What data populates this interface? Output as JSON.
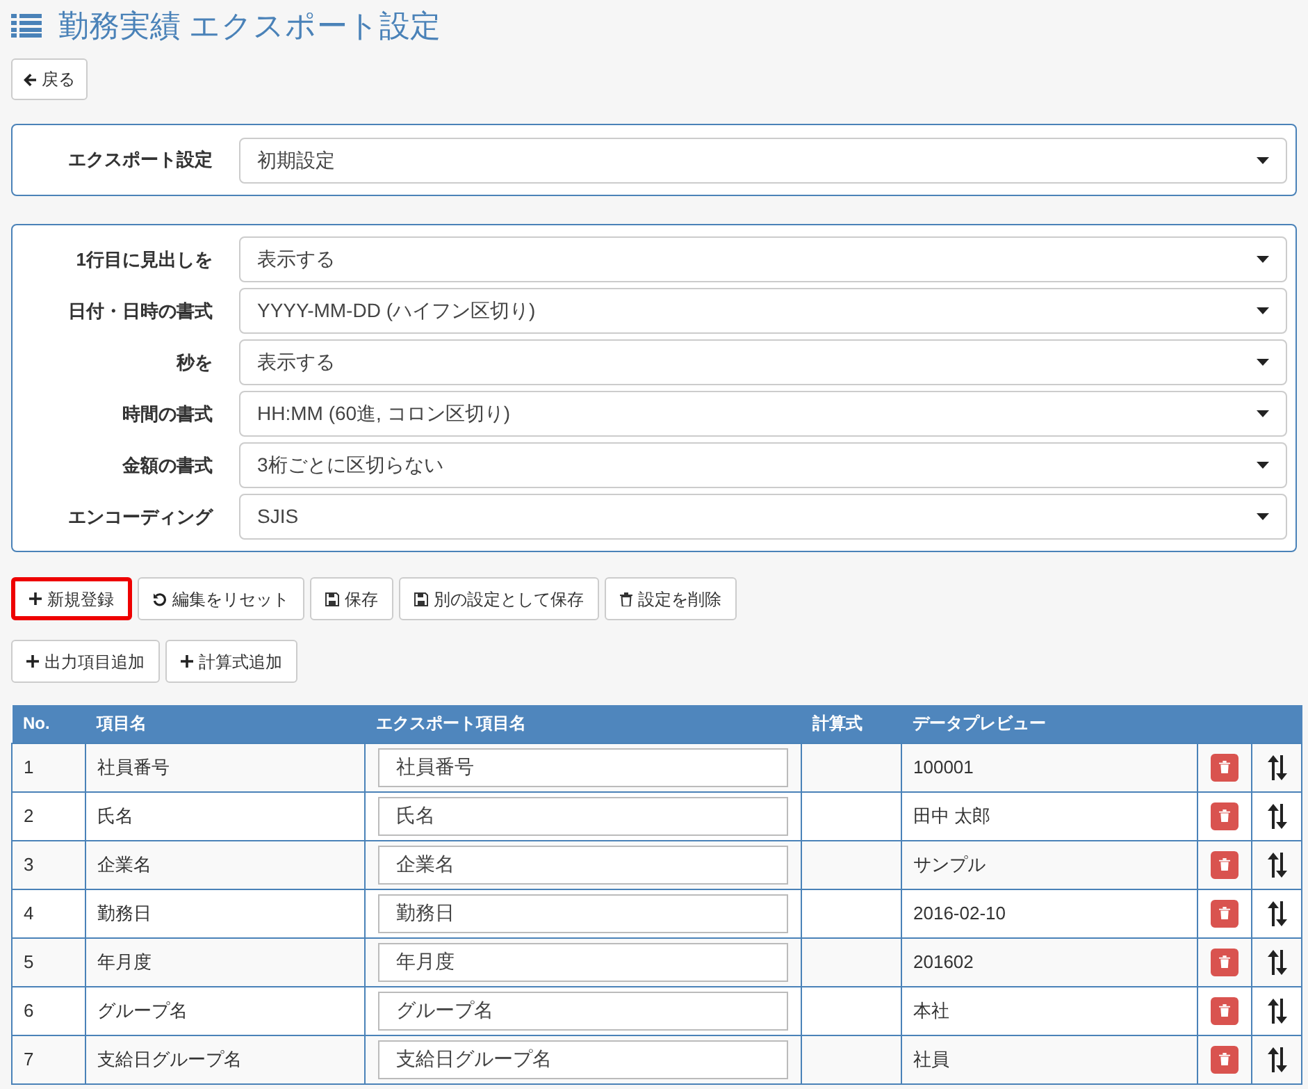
{
  "title": "勤務実績 エクスポート設定",
  "back_button": {
    "label": "戻る"
  },
  "preset": {
    "label": "エクスポート設定",
    "value": "初期設定"
  },
  "options": [
    {
      "label": "1行目に見出しを",
      "value": "表示する"
    },
    {
      "label": "日付・日時の書式",
      "value": "YYYY-MM-DD (ハイフン区切り)"
    },
    {
      "label": "秒を",
      "value": "表示する"
    },
    {
      "label": "時間の書式",
      "value": "HH:MM (60進, コロン区切り)"
    },
    {
      "label": "金額の書式",
      "value": "3桁ごとに区切らない"
    },
    {
      "label": "エンコーディング",
      "value": "SJIS"
    }
  ],
  "action_buttons": [
    {
      "label": "新規登録",
      "kind": "plus",
      "highlighted": true
    },
    {
      "label": "編集をリセット",
      "kind": "reset",
      "highlighted": false
    },
    {
      "label": "保存",
      "kind": "save",
      "highlighted": false
    },
    {
      "label": "別の設定として保存",
      "kind": "save",
      "highlighted": false
    },
    {
      "label": "設定を削除",
      "kind": "trash",
      "highlighted": false
    }
  ],
  "add_buttons": [
    {
      "label": "出力項目追加",
      "kind": "plus"
    },
    {
      "label": "計算式追加",
      "kind": "plus"
    }
  ],
  "table": {
    "columns": [
      "No.",
      "項目名",
      "エクスポート項目名",
      "計算式",
      "データプレビュー"
    ],
    "rows": [
      {
        "no": "1",
        "name": "社員番号",
        "export_name": "社員番号",
        "preview": "100001"
      },
      {
        "no": "2",
        "name": "氏名",
        "export_name": "氏名",
        "preview": "田中 太郎"
      },
      {
        "no": "3",
        "name": "企業名",
        "export_name": "企業名",
        "preview": "サンプル"
      },
      {
        "no": "4",
        "name": "勤務日",
        "export_name": "勤務日",
        "preview": "2016-02-10"
      },
      {
        "no": "5",
        "name": "年月度",
        "export_name": "年月度",
        "preview": "201602"
      },
      {
        "no": "6",
        "name": "グループ名",
        "export_name": "グループ名",
        "preview": "本社"
      },
      {
        "no": "7",
        "name": "支給日グループ名",
        "export_name": "支給日グループ名",
        "preview": "社員"
      }
    ]
  }
}
